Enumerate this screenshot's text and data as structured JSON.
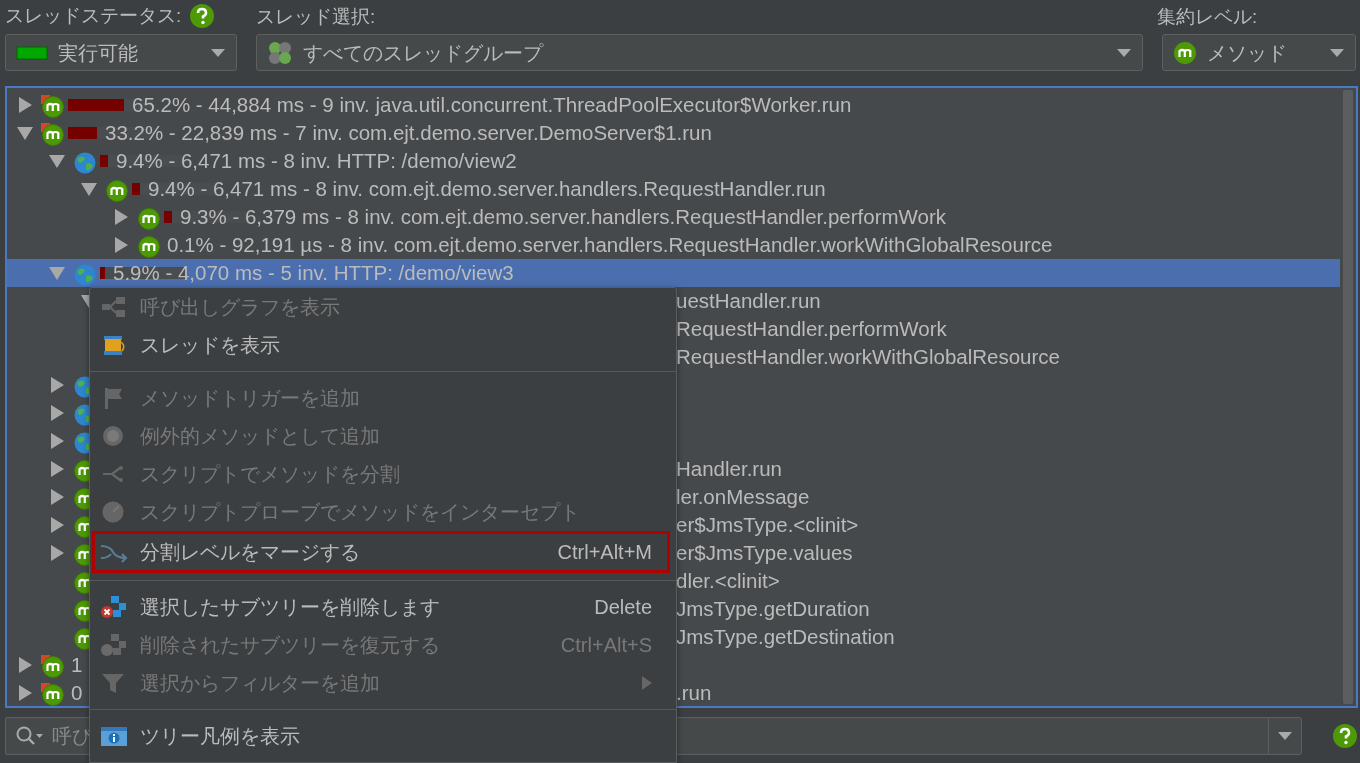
{
  "toolbar": {
    "thread_status": {
      "label": "スレッドステータス:",
      "value": "実行可能"
    },
    "thread_selection": {
      "label": "スレッド選択:",
      "value": "すべてのスレッドグループ"
    },
    "aggregation_level": {
      "label": "集約レベル:",
      "value": "メソッド"
    }
  },
  "tree": {
    "rows": [
      {
        "kind": "method",
        "hot_spot": true,
        "expanded": false,
        "level": 0.652,
        "text": "65.2% - 44,884 ms - 9 inv. java.util.concurrent.ThreadPoolExecutor$Worker.run",
        "selected": false
      },
      {
        "kind": "method",
        "hot_spot": true,
        "expanded": true,
        "level": 0.332,
        "text": "33.2% - 22,839 ms - 7 inv. com.ejt.demo.server.DemoServer$1.run",
        "selected": false,
        "children": [
          {
            "kind": "http",
            "hot_spot": false,
            "expanded": true,
            "level": 0.094,
            "text": "9.4% - 6,471 ms - 8 inv. HTTP: /demo/view2",
            "selected": false,
            "children": [
              {
                "kind": "method",
                "hot_spot": false,
                "expanded": true,
                "level": 0.094,
                "text": "9.4% - 6,471 ms - 8 inv. com.ejt.demo.server.handlers.RequestHandler.run",
                "selected": false,
                "children": [
                  {
                    "kind": "method",
                    "hot_spot": false,
                    "expanded": false,
                    "level": 0.093,
                    "text": "9.3% - 6,379 ms - 8 inv. com.ejt.demo.server.handlers.RequestHandler.performWork",
                    "selected": false
                  },
                  {
                    "kind": "method",
                    "hot_spot": false,
                    "expanded": false,
                    "text": "0.1% - 92,191 µs - 8 inv. com.ejt.demo.server.handlers.RequestHandler.workWithGlobalResource",
                    "selected": false
                  }
                ]
              }
            ]
          },
          {
            "kind": "http",
            "hot_spot": false,
            "expanded": true,
            "level": 0.059,
            "text": "5.9% - 4,070 ms - 5 inv. HTTP: /demo/view3",
            "selected": true,
            "children": [
              {
                "expanded": true,
                "tail": "uestHandler.run",
                "selected": false,
                "children": [
                  {
                    "tail": "RequestHandler.performWork",
                    "selected": false
                  },
                  {
                    "tail": "RequestHandler.workWithGlobalResource",
                    "selected": false
                  }
                ]
              }
            ]
          },
          {
            "kind": "http",
            "hot_spot": false,
            "expanded": false,
            "selected": false
          },
          {
            "kind": "http",
            "hot_spot": false,
            "expanded": false,
            "selected": false
          },
          {
            "kind": "http",
            "hot_spot": false,
            "expanded": false,
            "selected": false
          },
          {
            "kind": "method",
            "hot_spot": false,
            "expanded": false,
            "tail": "Handler.run",
            "selected": false
          },
          {
            "kind": "method",
            "hot_spot": false,
            "expanded": false,
            "tail": "ler.onMessage",
            "selected": false
          },
          {
            "kind": "method",
            "hot_spot": false,
            "expanded": false,
            "tail": "er$JmsType.<clinit>",
            "selected": false
          },
          {
            "kind": "method",
            "hot_spot": false,
            "expanded": false,
            "tail": "er$JmsType.values",
            "selected": false
          },
          {
            "kind": "method",
            "hot_spot": false,
            "tail": "dler.<clinit>",
            "selected": false
          },
          {
            "kind": "method",
            "hot_spot": false,
            "tail": "JmsType.getDuration",
            "selected": false
          },
          {
            "kind": "method",
            "hot_spot": false,
            "tail": "JmsType.getDestination",
            "selected": false
          }
        ]
      },
      {
        "kind": "method",
        "hot_spot": true,
        "expanded": false,
        "text": "1",
        "selected": false
      },
      {
        "kind": "method",
        "hot_spot": true,
        "expanded": false,
        "text": "0",
        "tail": ".run",
        "selected": false
      }
    ]
  },
  "context_menu": {
    "items": [
      {
        "kind": "item",
        "label": "呼び出しグラフを表示",
        "disabled": true,
        "highlighted": false
      },
      {
        "kind": "item",
        "label": "スレッドを表示",
        "disabled": false,
        "highlighted": false
      },
      {
        "kind": "separator"
      },
      {
        "kind": "item",
        "label": "メソッドトリガーを追加",
        "disabled": true,
        "highlighted": false
      },
      {
        "kind": "item",
        "label": "例外的メソッドとして追加",
        "disabled": true,
        "highlighted": false
      },
      {
        "kind": "item",
        "label": "スクリプトでメソッドを分割",
        "disabled": true,
        "highlighted": false
      },
      {
        "kind": "item",
        "label": "スクリプトプローブでメソッドをインターセプト",
        "disabled": true,
        "highlighted": false
      },
      {
        "kind": "item",
        "label": "分割レベルをマージする",
        "shortcut": "Ctrl+Alt+M",
        "disabled": false,
        "highlighted": true
      },
      {
        "kind": "separator"
      },
      {
        "kind": "item",
        "label": "選択したサブツリーを削除します",
        "shortcut": "Delete",
        "disabled": false,
        "highlighted": false
      },
      {
        "kind": "item",
        "label": "削除されたサブツリーを復元する",
        "shortcut": "Ctrl+Alt+S",
        "disabled": true,
        "highlighted": false
      },
      {
        "kind": "item",
        "label": "選択からフィルターを追加",
        "disabled": true,
        "highlighted": false,
        "submenu": true
      },
      {
        "kind": "separator"
      },
      {
        "kind": "item",
        "label": "ツリー凡例を表示",
        "disabled": false,
        "highlighted": false
      }
    ]
  },
  "search": {
    "placeholder": "呼び"
  }
}
